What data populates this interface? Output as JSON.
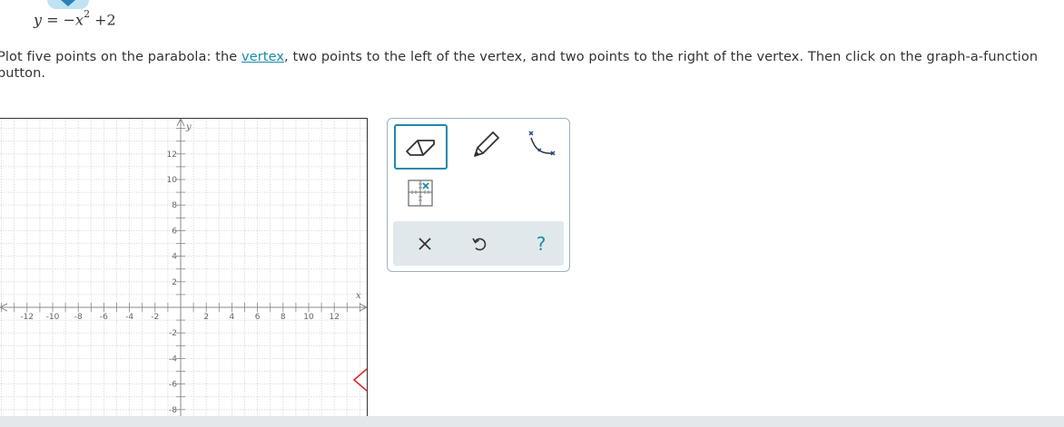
{
  "equation": {
    "y": "y",
    "eq": " = −",
    "x": "x",
    "exp": "2",
    "rest": " +2"
  },
  "instructions": {
    "before": "Plot five points on the parabola: the ",
    "link": "vertex",
    "after": ", two points to the left of the vertex, and two points to the right of the vertex. Then click on the graph-a-function button."
  },
  "graph": {
    "x_axis_label": "x",
    "y_axis_label": "y",
    "x_ticks": [
      "-12",
      "-10",
      "-8",
      "-6",
      "-4",
      "-2",
      "2",
      "4",
      "6",
      "8",
      "10",
      "12"
    ],
    "y_ticks": [
      "12",
      "10",
      "8",
      "6",
      "4",
      "2",
      "-2",
      "-4",
      "-6",
      "-8"
    ]
  },
  "toolbox": {
    "tools": [
      "eraser-icon",
      "pencil-icon",
      "graph-function-icon",
      "grid-point-icon"
    ],
    "actions": [
      "close-icon",
      "undo-icon",
      "help-icon"
    ],
    "help_label": "?"
  },
  "colors": {
    "accent": "#1b8aa8",
    "grid": "#d6d6d6",
    "axis": "#888888",
    "curve_marker": "#d9272e",
    "toolbar_bg": "#e1e8ec"
  }
}
